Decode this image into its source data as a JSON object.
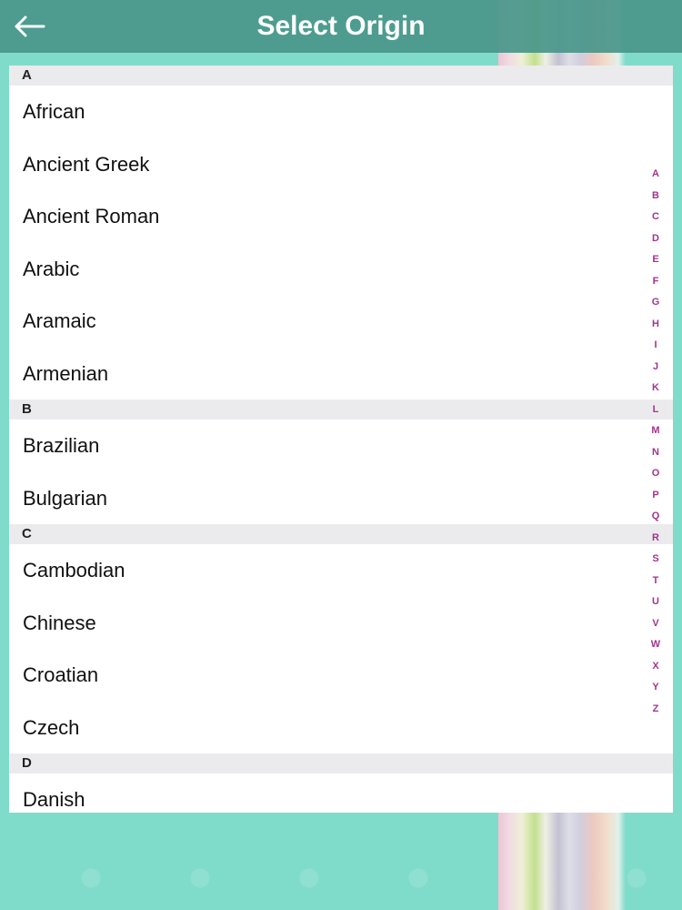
{
  "header": {
    "title": "Select Origin",
    "back_icon": "back-arrow-icon"
  },
  "sections": [
    {
      "letter": "A",
      "items": [
        "African",
        "Ancient Greek",
        "Ancient Roman",
        "Arabic",
        "Aramaic",
        "Armenian"
      ]
    },
    {
      "letter": "B",
      "items": [
        "Brazilian",
        "Bulgarian"
      ]
    },
    {
      "letter": "C",
      "items": [
        "Cambodian",
        "Chinese",
        "Croatian",
        "Czech"
      ]
    },
    {
      "letter": "D",
      "items": [
        "Danish"
      ]
    }
  ],
  "index_letters": [
    "A",
    "B",
    "C",
    "D",
    "E",
    "F",
    "G",
    "H",
    "I",
    "J",
    "K",
    "L",
    "M",
    "N",
    "O",
    "P",
    "Q",
    "R",
    "S",
    "T",
    "U",
    "V",
    "W",
    "X",
    "Y",
    "Z"
  ],
  "colors": {
    "header_bg": "#49968a",
    "background": "#7fdcca",
    "index_letter": "#a4338f",
    "section_header_bg": "#ebebed"
  }
}
